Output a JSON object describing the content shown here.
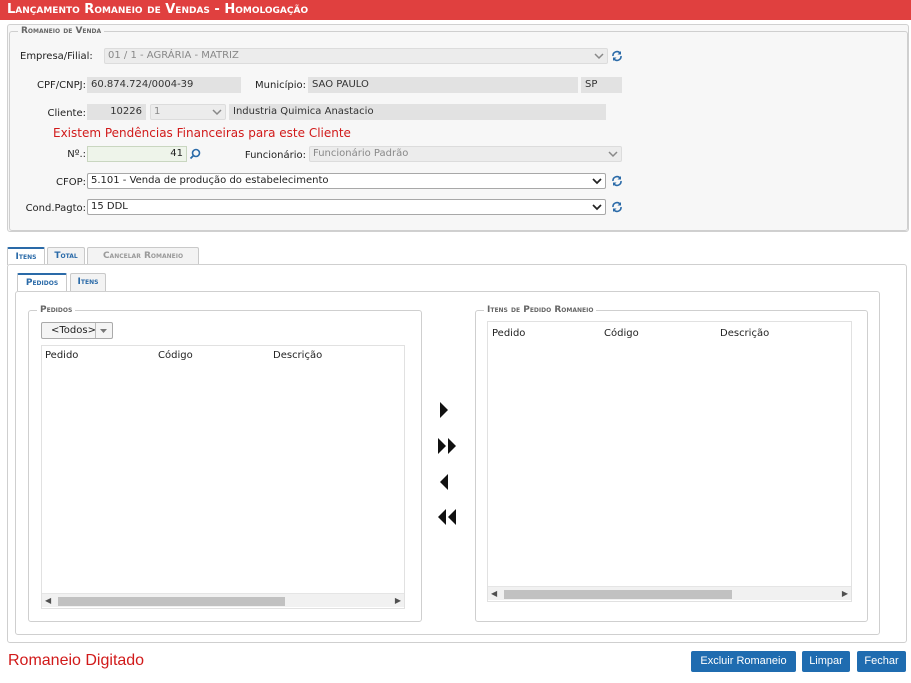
{
  "title": "Lançamento Romaneio de Vendas  - Homologação",
  "romaneio": {
    "legend": "Romaneio de Venda",
    "empresa_label": "Empresa/Filial:",
    "empresa_value": "01 / 1 - AGRÁRIA - MATRIZ",
    "cpf_label": "CPF/CNPJ:",
    "cpf_value": "60.874.724/0004-39",
    "municipio_label": "Município:",
    "municipio_value": "SAO PAULO",
    "uf_value": "SP",
    "cliente_label": "Cliente:",
    "cliente_code": "10226",
    "cliente_loja": "1",
    "cliente_name": "Industria Quimica Anastacio",
    "warning": "Existem Pendências Financeiras para este Cliente",
    "numero_label": "Nº.:",
    "numero_value": "41",
    "funcionario_label": "Funcionário:",
    "funcionario_value": "Funcionário Padrão",
    "cfop_label": "CFOP:",
    "cfop_value": "5.101 - Venda de produção do estabelecimento",
    "condpagto_label": "Cond.Pagto:",
    "condpagto_value": "15 DDL"
  },
  "tabs": [
    "Itens",
    "Total",
    "Cancelar Romaneio"
  ],
  "subtabs": [
    "Pedidos",
    "Itens"
  ],
  "pedidos": {
    "legend": "Pedidos",
    "filter": "<Todos>",
    "columns": [
      "Pedido",
      "Código",
      "Descrição"
    ]
  },
  "itens_pedido": {
    "legend": "Itens de Pedido Romaneio",
    "columns": [
      "Pedido",
      "Código",
      "Descrição"
    ]
  },
  "footer": {
    "status": "Romaneio Digitado",
    "excluir": "Excluir Romaneio",
    "limpar": "Limpar",
    "fechar": "Fechar"
  },
  "colors": {
    "title_bar": "#e0403f",
    "accent": "#1f6cb0",
    "warning": "#d11a1a"
  }
}
